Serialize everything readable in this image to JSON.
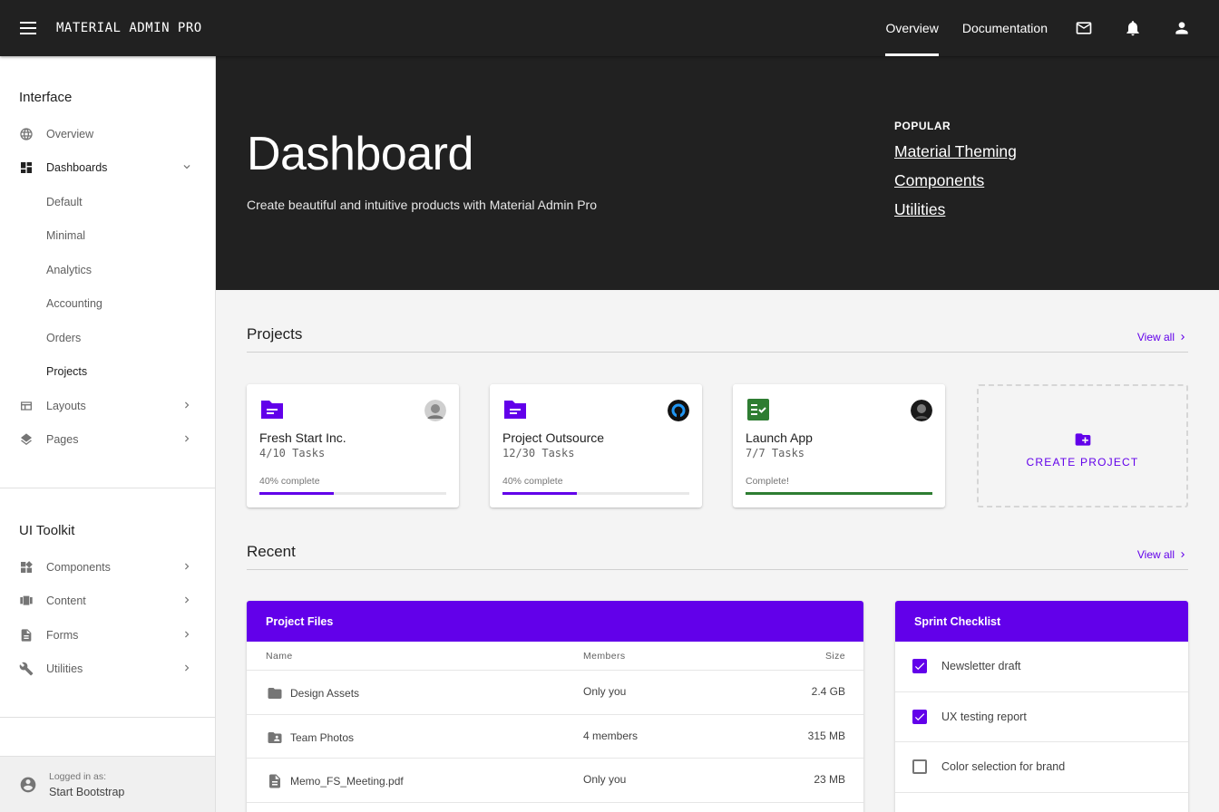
{
  "topbar": {
    "brand": "MATERIAL ADMIN PRO",
    "tabs": [
      {
        "label": "Overview",
        "active": true
      },
      {
        "label": "Documentation",
        "active": false
      }
    ],
    "icons": [
      "mail-icon",
      "bell-icon",
      "account-icon"
    ]
  },
  "sidebar": {
    "interface_heading": "Interface",
    "overview": "Overview",
    "dashboards": "Dashboards",
    "dash_default": "Default",
    "dash_minimal": "Minimal",
    "dash_analytics": "Analytics",
    "dash_accounting": "Accounting",
    "dash_orders": "Orders",
    "dash_projects": "Projects",
    "layouts": "Layouts",
    "pages": "Pages",
    "toolkit_heading": "UI Toolkit",
    "components": "Components",
    "content": "Content",
    "forms": "Forms",
    "utilities": "Utilities",
    "footer_label": "Logged in as:",
    "footer_name": "Start Bootstrap"
  },
  "hero": {
    "title": "Dashboard",
    "subtitle": "Create beautiful and intuitive products with Material Admin Pro",
    "popular_label": "POPULAR",
    "links": [
      "Material Theming",
      "Components",
      "Utilities"
    ]
  },
  "projects": {
    "title": "Projects",
    "view_all": "View all",
    "cards": [
      {
        "name": "Fresh Start Inc.",
        "tasks": "4/10 Tasks",
        "status": "40% complete",
        "progress": 0.4,
        "color": "#6200ea"
      },
      {
        "name": "Project Outsource",
        "tasks": "12/30 Tasks",
        "status": "40% complete",
        "progress": 0.4,
        "color": "#6200ea"
      },
      {
        "name": "Launch App",
        "tasks": "7/7 Tasks",
        "status": "Complete!",
        "progress": 1.0,
        "color": "#2e7d32"
      }
    ],
    "create_label": "CREATE PROJECT"
  },
  "recent": {
    "title": "Recent",
    "view_all": "View all"
  },
  "files": {
    "title": "Project Files",
    "col_name": "Name",
    "col_members": "Members",
    "col_size": "Size",
    "rows": [
      {
        "name": "Design Assets",
        "members": "Only you",
        "size": "2.4 GB",
        "icon": "folder-icon"
      },
      {
        "name": "Team Photos",
        "members": "4 members",
        "size": "315 MB",
        "icon": "shared-folder-icon"
      },
      {
        "name": "Memo_FS_Meeting.pdf",
        "members": "Only you",
        "size": "23 MB",
        "icon": "document-icon"
      }
    ]
  },
  "checklist": {
    "title": "Sprint Checklist",
    "items": [
      {
        "label": "Newsletter draft",
        "checked": true
      },
      {
        "label": "UX testing report",
        "checked": true
      },
      {
        "label": "Color selection for brand",
        "checked": false
      }
    ]
  },
  "colors": {
    "accent": "#6200ea",
    "success": "#2e7d32",
    "dark": "#212121"
  }
}
